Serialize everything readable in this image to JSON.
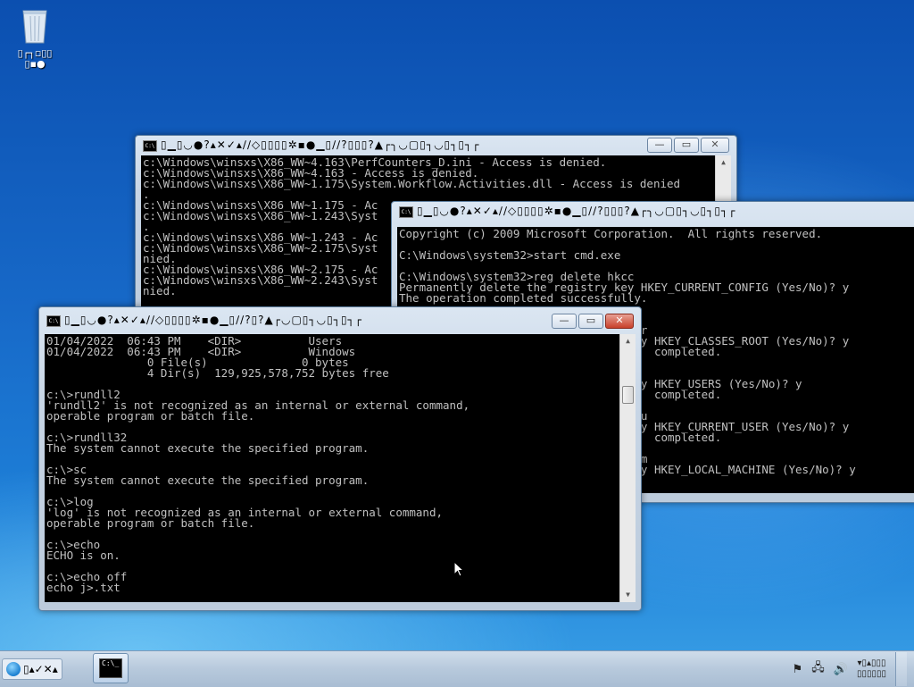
{
  "desktop": {
    "recycle_bin_label": "▯┌┐▫▯▯\n▯▪●"
  },
  "windows": {
    "back": {
      "title": "▯▁▯◡●?▴✕✓▴∕∕◇▯▯▯▯✲▪●▁▯∕∕?▯▯▯?▲┌╮◡▢▯┐◡▯┐▯┐┌",
      "lines": [
        "c:\\Windows\\winsxs\\X86_WW~4.163\\PerfCounters_D.ini - Access is denied.",
        "c:\\Windows\\winsxs\\X86_WW~4.163 - Access is denied.",
        "c:\\Windows\\winsxs\\X86_WW~1.175\\System.Workflow.Activities.dll - Access is denied",
        ".",
        "c:\\Windows\\winsxs\\X86_WW~1.175 - Ac",
        "c:\\Windows\\winsxs\\X86_WW~1.243\\Syst",
        ".",
        "c:\\Windows\\winsxs\\X86_WW~1.243 - Ac",
        "c:\\Windows\\winsxs\\X86_WW~2.175\\Syst",
        "nied.",
        "c:\\Windows\\winsxs\\X86_WW~2.175 - Ac",
        "c:\\Windows\\winsxs\\X86_WW~2.243\\Syst",
        "nied."
      ]
    },
    "middle": {
      "title": "▯▁▯◡●?▴✕✓▴∕∕◇▯▯▯▯✲▪●▁▯∕∕?▯▯▯?▲┌╮◡▢▯┐◡▯┐▯┐┌",
      "lines": [
        "Copyright (c) 2009 Microsoft Corporation.  All rights reserved.",
        "",
        "C:\\Windows\\system32>start cmd.exe",
        "",
        "C:\\Windows\\system32>reg delete hkcc",
        "Permanently delete the registry key HKEY_CURRENT_CONFIG (Yes/No)? y",
        "The operation completed successfully.",
        "",
        "",
        "                                    r",
        "                                    y HKEY_CLASSES_ROOT (Yes/No)? y",
        "                                      completed.",
        "",
        "",
        "                                    y HKEY_USERS (Yes/No)? y",
        "                                      completed.",
        "",
        "                                    u",
        "                                    y HKEY_CURRENT_USER (Yes/No)? y",
        "                                      completed.",
        "",
        "                                    m",
        "                                    y HKEY_LOCAL_MACHINE (Yes/No)? y"
      ]
    },
    "front": {
      "title": "▯▁▯◡●?▴✕✓▴∕∕◇▯▯▯▯✲▪●▁▯∕∕?▯?▲┌◡▢▯┐◡▯┐▯┐┌",
      "lines": [
        "01/04/2022  06:43 PM    <DIR>          Users",
        "01/04/2022  06:43 PM    <DIR>          Windows",
        "               0 File(s)              0 bytes",
        "               4 Dir(s)  129,925,578,752 bytes free",
        "",
        "c:\\>rundll2",
        "'rundll2' is not recognized as an internal or external command,",
        "operable program or batch file.",
        "",
        "c:\\>rundll32",
        "The system cannot execute the specified program.",
        "",
        "c:\\>sc",
        "The system cannot execute the specified program.",
        "",
        "c:\\>log",
        "'log' is not recognized as an internal or external command,",
        "operable program or batch file.",
        "",
        "c:\\>echo",
        "ECHO is on.",
        "",
        "c:\\>echo off",
        "echo j>.txt"
      ]
    }
  },
  "window_controls": {
    "minimize": "—",
    "maximize": "▭",
    "close": "✕"
  },
  "taskbar": {
    "start_label": "▯▴✓✕▴",
    "task_icon_text": "C:\\_",
    "clock": "▾▯▴▯▯▯\n▯▯▯▯▯▯"
  },
  "colors": {
    "console_bg": "#000000",
    "console_fg": "#c0c0c0",
    "close_button": "#c8402a"
  }
}
